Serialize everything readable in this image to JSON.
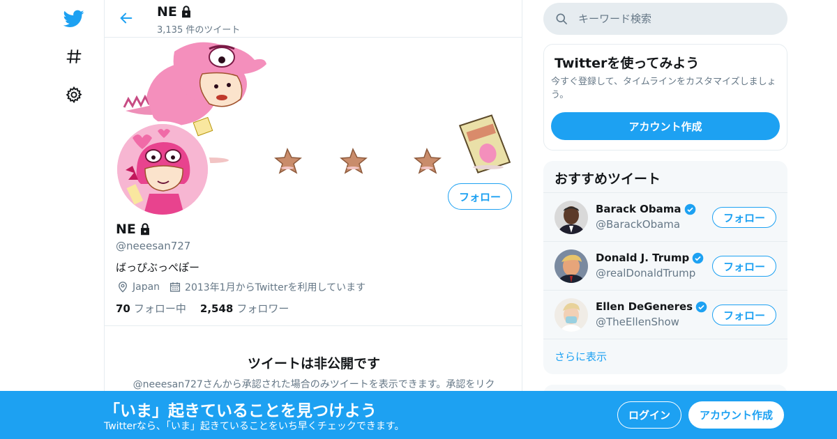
{
  "colors": {
    "accent": "#1da1f2",
    "text": "#14171a",
    "secondary": "#657786",
    "border": "#e6ecf0",
    "avatar_pink": "#f7b6d2"
  },
  "nav": {
    "icons": [
      "twitter-logo-icon",
      "hashtag-icon",
      "gear-icon"
    ]
  },
  "header": {
    "name": "NE",
    "tweet_count": "3,135 件のツイート"
  },
  "profile": {
    "name": "NE",
    "handle": "@neeesan727",
    "bio": "ばっぴぶっぺぽー",
    "location": "Japan",
    "joined": "2013年1月からTwitterを利用しています",
    "following_count": "70",
    "following_label": "フォロー中",
    "followers_count": "2,548",
    "followers_label": "フォロワー",
    "follow_button": "フォロー"
  },
  "private_notice": {
    "title": "ツイートは非公開です",
    "description": "@neeesan727さんから承認された場合のみツイートを表示できます。承認をリク"
  },
  "search": {
    "placeholder": "キーワード検索"
  },
  "signup_card": {
    "title": "Twitterを使ってみよう",
    "text": "今すぐ登録して、タイムラインをカスタマイズしましょう。",
    "button": "アカウント作成"
  },
  "who_to_follow": {
    "title": "おすすめツイート",
    "users": [
      {
        "name": "Barack Obama",
        "handle": "@BarackObama",
        "button": "フォロー"
      },
      {
        "name": "Donald J. Trump",
        "handle": "@realDonaldTrump",
        "button": "フォロー"
      },
      {
        "name": "Ellen DeGeneres",
        "handle": "@TheEllenShow",
        "button": "フォロー"
      }
    ],
    "show_more": "さらに表示"
  },
  "bottom_bar": {
    "title": "「いま」起きていることを見つけよう",
    "subtitle": "Twitterなら、「いま」起きていることをいち早くチェックできます。",
    "login": "ログイン",
    "signup": "アカウント作成"
  }
}
